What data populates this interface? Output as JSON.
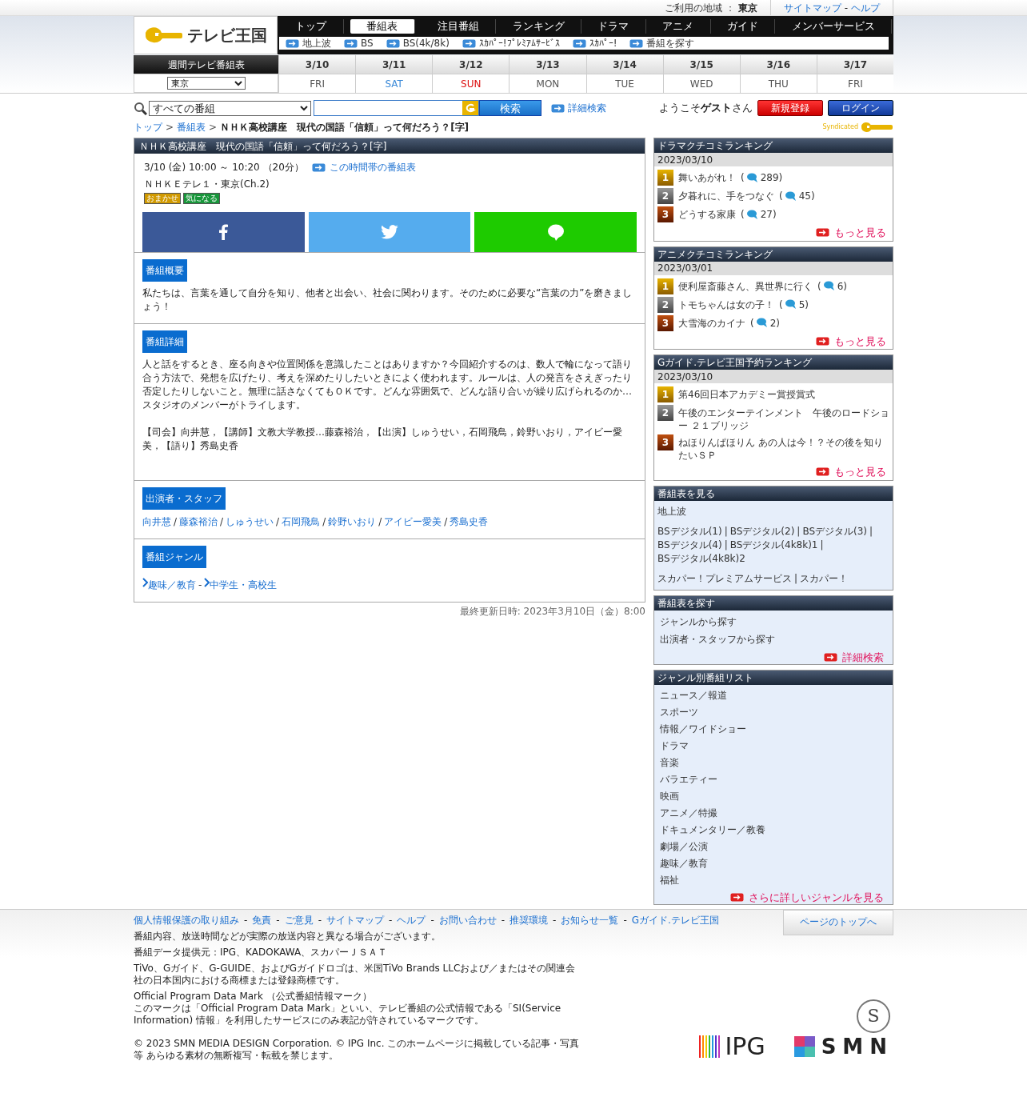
{
  "top_bar": {
    "region_label": "ご利用の地域 ：",
    "region": "東京",
    "links": [
      "サイトマップ",
      "ヘルプ"
    ],
    "separator": "-"
  },
  "logo": {
    "text": "テレビ王国"
  },
  "nav": {
    "tabs": [
      {
        "label": "トップ",
        "selected": false
      },
      {
        "label": "番組表",
        "selected": true
      },
      {
        "label": "注目番組",
        "selected": false
      },
      {
        "label": "ランキング",
        "selected": false
      },
      {
        "label": "ドラマ",
        "selected": false
      },
      {
        "label": "アニメ",
        "selected": false
      },
      {
        "label": "ガイド",
        "selected": false
      },
      {
        "label": "メンバーサービス",
        "selected": false
      }
    ],
    "sub_links": [
      "地上波",
      "BS",
      "BS(4k/8k)",
      "ｽｶﾊﾟｰ!ﾌﾟﾚﾐｱﾑｻｰﾋﾞｽ",
      "ｽｶﾊﾟｰ!",
      "番組を探す"
    ]
  },
  "week": {
    "title": "週間テレビ番組表",
    "region_select": "東京",
    "days": [
      {
        "date": "3/10",
        "weekday": "FRI",
        "kind": "weekday"
      },
      {
        "date": "3/11",
        "weekday": "SAT",
        "kind": "saturday"
      },
      {
        "date": "3/12",
        "weekday": "SUN",
        "kind": "sunday"
      },
      {
        "date": "3/13",
        "weekday": "MON",
        "kind": "weekday"
      },
      {
        "date": "3/14",
        "weekday": "TUE",
        "kind": "weekday"
      },
      {
        "date": "3/15",
        "weekday": "WED",
        "kind": "weekday"
      },
      {
        "date": "3/16",
        "weekday": "THU",
        "kind": "weekday"
      },
      {
        "date": "3/17",
        "weekday": "FRI",
        "kind": "weekday"
      }
    ]
  },
  "search": {
    "scope": "すべての番組",
    "button": "検索",
    "advanced": "詳細検索"
  },
  "user": {
    "greeting": "ようこそ**ゲスト**さん",
    "register": "新規登録",
    "login": "ログイン"
  },
  "syndicated": "Syndicated",
  "breadcrumb": {
    "links": [
      "トップ",
      "番組表"
    ],
    "separator": ">",
    "current": "ＮＨＫ高校講座　現代の国語「信頼」って何だろう？[字]"
  },
  "program": {
    "title": "ＮＨＫ高校講座　現代の国語「信頼」って何だろう？[字]",
    "time": "3/10 (金) 10:00 ～ 10:20 （20分）",
    "schedule_link": "この時間帯の番組表",
    "channel": "ＮＨＫＥテレ１・東京(Ch.2)",
    "badges": [
      {
        "label": "おまかせ",
        "color": "#d19a00"
      },
      {
        "label": "気になる",
        "color": "#17963a"
      }
    ],
    "share": [
      {
        "kind": "facebook"
      },
      {
        "kind": "twitter"
      },
      {
        "kind": "line"
      }
    ],
    "sections": [
      {
        "kind": "text",
        "heading": "番組概要",
        "paragraphs": [
          "私たちは、言葉を通して自分を知り、他者と出会い、社会に関わります。そのために必要な“言葉の力”を磨きましょう！"
        ]
      },
      {
        "kind": "text",
        "heading": "番組詳細",
        "paragraphs": [
          "人と話をするとき、座る向きや位置関係を意識したことはありますか？今回紹介するのは、数人で輪になって語り合う方法で、発想を広げたり、考えを深めたりしたいときによく使われます。ルールは、人の発言をさえぎったり否定したりしないこと。無理に話さなくてもＯＫです。どんな雰囲気で、どんな語り合いが繰り広げられるのか…スタジオのメンバーがトライします。",
          "【司会】向井慧，【講師】文教大学教授…藤森裕治，【出演】しゅうせい，石岡飛鳥，鈴野いおり，アイビー愛美，【語り】秀島史香"
        ]
      },
      {
        "kind": "people",
        "heading": "出演者・スタッフ",
        "separator": "/",
        "links": [
          "向井慧",
          "藤森裕治",
          "しゅうせい",
          "石岡飛鳥",
          "鈴野いおり",
          "アイビー愛美",
          "秀島史香"
        ]
      },
      {
        "kind": "genres",
        "heading": "番組ジャンル",
        "separator": "-",
        "links": [
          "趣味／教育",
          "中学生・高校生"
        ]
      }
    ],
    "updated": "最終更新日時: 2023年3月10日（金）8:00"
  },
  "comment_brackets": [
    "(",
    ")"
  ],
  "rankings": [
    {
      "title": "ドラマクチコミランキング",
      "date": "2023/03/10",
      "more": "もっと見る",
      "items": [
        {
          "rank": "1",
          "title": "舞いあがれ！",
          "comments": "289"
        },
        {
          "rank": "2",
          "title": "夕暮れに、手をつなぐ",
          "comments": "45"
        },
        {
          "rank": "3",
          "title": "どうする家康",
          "comments": "27"
        }
      ]
    },
    {
      "title": "アニメクチコミランキング",
      "date": "2023/03/01",
      "more": "もっと見る",
      "items": [
        {
          "rank": "1",
          "title": "便利屋斎藤さん、異世界に行く",
          "comments": "6"
        },
        {
          "rank": "2",
          "title": "トモちゃんは女の子！",
          "comments": "5"
        },
        {
          "rank": "3",
          "title": "大雪海のカイナ",
          "comments": "2"
        }
      ]
    },
    {
      "title": "Gガイド.テレビ王国予約ランキング",
      "date": "2023/03/10",
      "more": "もっと見る",
      "items": [
        {
          "rank": "1",
          "title": "第46回日本アカデミー賞授賞式"
        },
        {
          "rank": "2",
          "title": "午後のエンターテインメント　午後のロードショー ２１ブリッジ"
        },
        {
          "rank": "3",
          "title": "ねほりんぱほりん あの人は今！？その後を知りたいＳＰ"
        }
      ]
    }
  ],
  "schedule_box": {
    "title": "番組表を見る",
    "separator": "|",
    "groups": [
      [
        "地上波"
      ],
      [
        "BSデジタル(1)",
        "BSデジタル(2)",
        "BSデジタル(3)",
        "BSデジタル(4)",
        "BSデジタル(4k8k)1",
        "BSデジタル(4k8k)2"
      ],
      [
        "スカパー！プレミアムサービス",
        "スカパー！"
      ]
    ]
  },
  "search_box": {
    "title": "番組表を探す",
    "links": [
      "ジャンルから探す",
      "出演者・スタッフから探す"
    ],
    "more": "詳細検索"
  },
  "genre_box": {
    "title": "ジャンル別番組リスト",
    "links": [
      "ニュース／報道",
      "スポーツ",
      "情報／ワイドショー",
      "ドラマ",
      "音楽",
      "バラエティー",
      "映画",
      "アニメ／特撮",
      "ドキュメンタリー／教養",
      "劇場／公演",
      "趣味／教育",
      "福祉"
    ],
    "more": "さらに詳しいジャンルを見る"
  },
  "footer": {
    "links": [
      "個人情報保護の取り組み",
      "免責",
      "ご意見",
      "サイトマップ",
      "ヘルプ",
      "お問い合わせ",
      "推奨環境",
      "お知らせ一覧",
      "Gガイド.テレビ王国"
    ],
    "separator": "-",
    "top_button": "ページのトップへ",
    "notes": [
      [
        "番組内容、放送時間などが実際の放送内容と異なる場合がございます。"
      ],
      [
        "番組データ提供元：IPG、KADOKAWA、スカパーＪＳＡＴ"
      ],
      [
        "TiVo、Gガイド、G-GUIDE、およびGガイドロゴは、米国TiVo Brands LLCおよび／またはその関連会社の日本国内における商標または登録商標です。"
      ],
      [
        "Official Program Data Mark （公式番組情報マーク）",
        "このマークは「Official Program Data Mark」といい、テレビ番組の公式情報である「SI(Service Information) 情報」を利用したサービスにのみ表記が許されているマークです。"
      ],
      [
        "© 2023 SMN MEDIA DESIGN Corporation. © IPG Inc. このホームページに掲載している記事・写真等 あらゆる素材の無断複写・転載を禁じます。"
      ]
    ],
    "seal": "S",
    "logos": [
      "IPG",
      "SMN"
    ]
  }
}
